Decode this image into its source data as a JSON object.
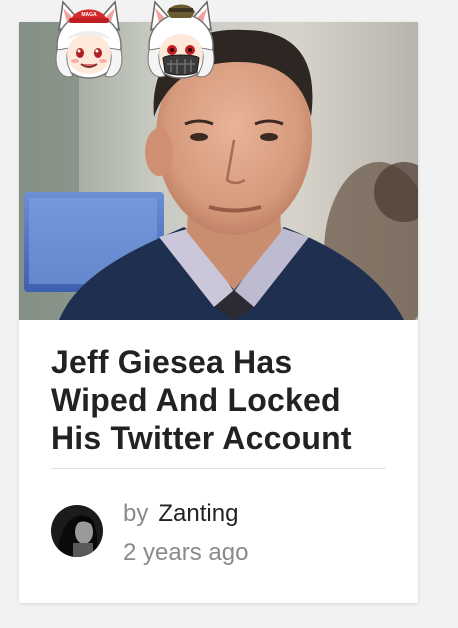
{
  "article": {
    "title": "Jeff Giesea Has Wiped And Locked His Twitter Account",
    "photo_subject": "man-portrait-photo"
  },
  "byline": {
    "prefix": "by",
    "author": "Zanting",
    "timestamp": "2 years ago"
  },
  "badges": [
    {
      "name": "smiling-anime-wolf-girl-badge",
      "hat_text": "MAGA"
    },
    {
      "name": "masked-anime-wolf-girl-badge"
    }
  ],
  "colors": {
    "page_bg": "#f2f2f2",
    "card_bg": "#ffffff",
    "title_text": "#222222",
    "muted_text": "#8a8a8a",
    "divider": "#e3e3e3"
  }
}
